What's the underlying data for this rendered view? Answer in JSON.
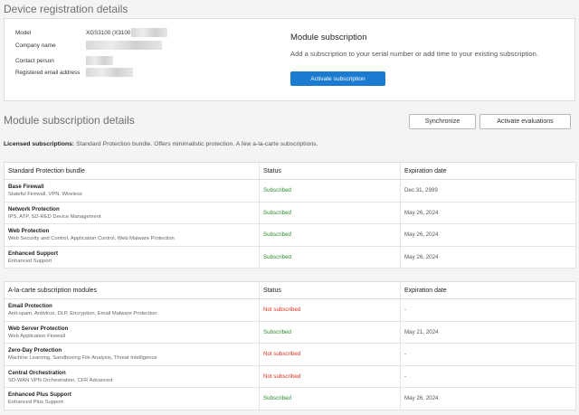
{
  "registration": {
    "title": "Device registration details",
    "model_label": "Model",
    "model_value": "XGS3100 (X3100",
    "company_label": "Company name",
    "contact_label": "Contact person",
    "email_label": "Registered email address"
  },
  "module_subscription": {
    "title": "Module subscription",
    "description": "Add a subscription to your serial number or add time to your existing subscription.",
    "activate_button": "Activate subscription"
  },
  "details": {
    "title": "Module subscription details",
    "sync_button": "Synchronize",
    "evaluate_button": "Activate evaluations",
    "licensed_label": "Licensed subscriptions:",
    "licensed_text": "Standard Protection bundle. Offers minimalistic protection. A few a-la-carte subscriptions."
  },
  "standard_table": {
    "headers": [
      "Standard Protection bundle",
      "Status",
      "Expiration date"
    ],
    "rows": [
      {
        "name": "Base Firewall",
        "desc": "Stateful Firewall, VPN, Wireless",
        "status": "Subscribed",
        "expiration": "Dec 31, 2999",
        "ok": true
      },
      {
        "name": "Network Protection",
        "desc": "IPS, ATP, SD-RED Device Management",
        "status": "Subscribed",
        "expiration": "May 26, 2024",
        "ok": true
      },
      {
        "name": "Web Protection",
        "desc": "Web Security and Control, Application Control, Web Malware Protection",
        "status": "Subscribed",
        "expiration": "May 26, 2024",
        "ok": true
      },
      {
        "name": "Enhanced Support",
        "desc": "Enhanced Support",
        "status": "Subscribed",
        "expiration": "May 26, 2024",
        "ok": true
      }
    ]
  },
  "alacarte_table": {
    "headers": [
      "A-la-carte subscription modules",
      "Status",
      "Expiration date"
    ],
    "rows": [
      {
        "name": "Email Protection",
        "desc": "Anti-spam, Antivirus, DLP, Encryption, Email Malware Protection",
        "status": "Not subscribed",
        "expiration": "-",
        "ok": false
      },
      {
        "name": "Web Server Protection",
        "desc": "Web Application Firewall",
        "status": "Subscribed",
        "expiration": "May 21, 2024",
        "ok": true
      },
      {
        "name": "Zero-Day Protection",
        "desc": "Machine Learning, Sandboxing File Analysis, Threat Intelligence",
        "status": "Not subscribed",
        "expiration": "-",
        "ok": false
      },
      {
        "name": "Central Orchestration",
        "desc": "SD-WAN VPN Orchestration, CFR Advanced",
        "status": "Not subscribed",
        "expiration": "-",
        "ok": false
      },
      {
        "name": "Enhanced Plus Support",
        "desc": "Enhanced Plus Support",
        "status": "Subscribed",
        "expiration": "May 26, 2024",
        "ok": true
      }
    ]
  },
  "colors": {
    "accent": "#1a7bd1",
    "subscribed": "#2e8b2e",
    "not_subscribed": "#e0301e"
  }
}
